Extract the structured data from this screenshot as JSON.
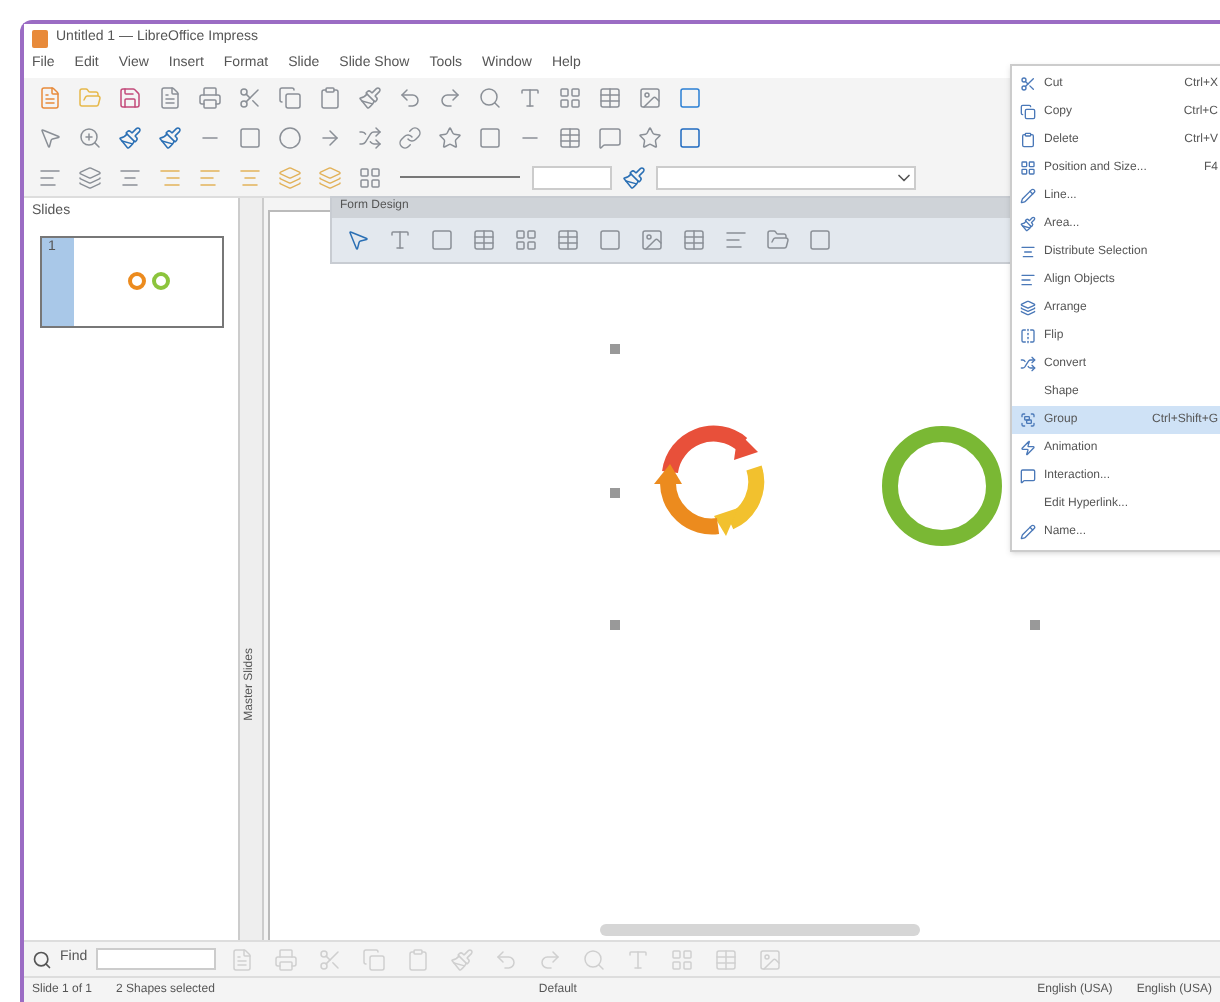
{
  "window": {
    "title": "Untitled 1 — LibreOffice Impress"
  },
  "menu_bar": [
    "File",
    "Edit",
    "View",
    "Insert",
    "Format",
    "Slide",
    "Slide Show",
    "Tools",
    "Window",
    "Help"
  ],
  "slides_pane": {
    "title": "Slides",
    "slides": [
      {
        "number": "1",
        "selected": true
      }
    ]
  },
  "side_tab": {
    "label": "Master Slides"
  },
  "form_design_toolbar": {
    "title": "Form Design"
  },
  "context_menu": [
    {
      "label": "Cut",
      "shortcut": "Ctrl+X",
      "selected": false
    },
    {
      "label": "Copy",
      "shortcut": "Ctrl+C",
      "selected": false
    },
    {
      "label": "Delete",
      "shortcut": "Ctrl+V",
      "selected": false
    },
    {
      "label": "Position and Size...",
      "shortcut": "F4",
      "selected": false
    },
    {
      "label": "Line...",
      "selected": false
    },
    {
      "label": "Area...",
      "selected": false
    },
    {
      "label": "Distribute Selection",
      "selected": false
    },
    {
      "label": "Align Objects",
      "selected": false
    },
    {
      "label": "Arrange",
      "selected": false
    },
    {
      "label": "Flip",
      "selected": false
    },
    {
      "label": "Convert",
      "selected": false
    },
    {
      "label": "Shape",
      "selected": false
    },
    {
      "label": "Group",
      "shortcut": "Ctrl+Shift+G",
      "selected": true
    },
    {
      "label": "Animation",
      "selected": false
    },
    {
      "label": "Interaction...",
      "selected": false
    },
    {
      "label": "Edit Hyperlink...",
      "selected": false
    },
    {
      "label": "Name...",
      "selected": false
    }
  ],
  "find_bar": {
    "label": "Find"
  },
  "status_bar": [
    "Slide 1 of 1",
    "2 Shapes selected",
    "Default",
    "English (USA)",
    "English (USA)"
  ]
}
